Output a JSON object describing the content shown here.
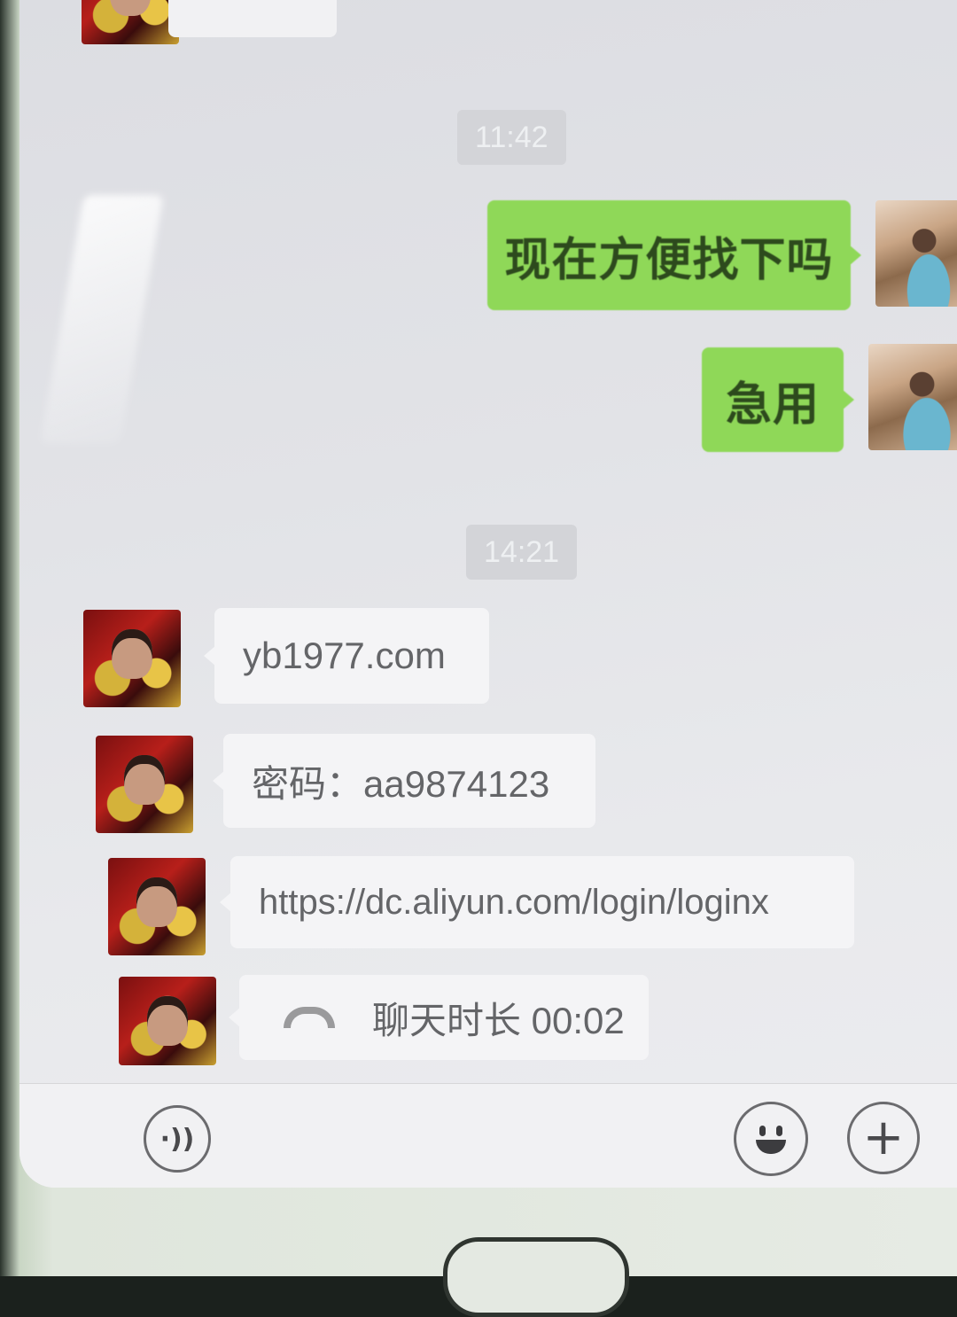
{
  "chat": {
    "timestamps": [
      "11:42",
      "14:21"
    ],
    "outgoing": [
      {
        "text": "现在方便找下吗"
      },
      {
        "text": "急用"
      }
    ],
    "incoming": [
      {
        "text": "yb1977.com"
      },
      {
        "text": "密码：aa9874123"
      },
      {
        "text": "https://dc.aliyun.com/login/loginx"
      },
      {
        "text": "聊天时长 00:02",
        "icon": "phone-handset-icon"
      }
    ]
  },
  "toolbar": {
    "voice_icon": "voice-icon",
    "emoji_icon": "emoji-icon",
    "plus_icon": "plus-icon"
  },
  "colors": {
    "outgoing_bubble": "#8fd858",
    "incoming_bubble": "#f4f4f6",
    "background": "#e2e3e7"
  }
}
